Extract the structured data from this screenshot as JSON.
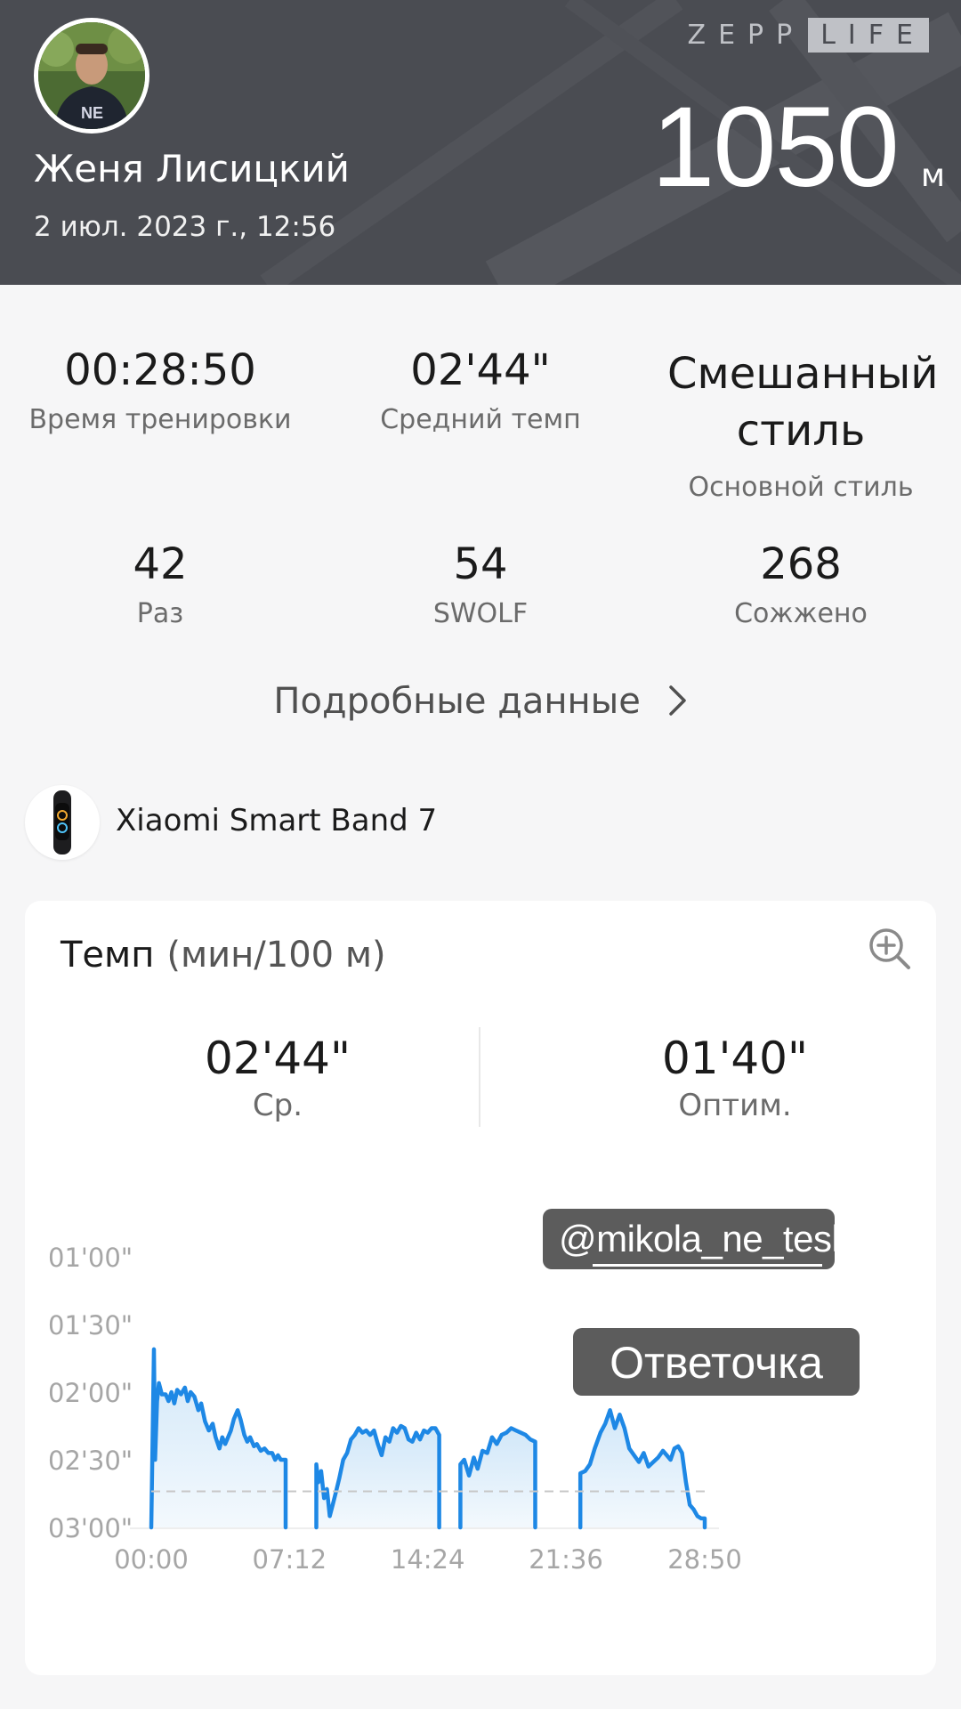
{
  "header": {
    "brand_left": "ZEPP",
    "brand_right": "LIFE",
    "user_name": "Женя Лисицкий",
    "date": "2 июл. 2023 г., 12:56",
    "distance_value": "1050",
    "distance_unit": "м"
  },
  "stats": [
    {
      "value": "00:28:50",
      "label": "Время тренировки"
    },
    {
      "value": "02'44\"",
      "label": "Средний темп"
    },
    {
      "value": "Смешанный стиль",
      "label": "Основной стиль"
    },
    {
      "value": "42",
      "label": "Раз"
    },
    {
      "value": "54",
      "label": "SWOLF"
    },
    {
      "value": "268",
      "label": "Сожжено"
    }
  ],
  "details_link": "Подробные данные",
  "device": {
    "name": "Xiaomi Smart Band 7",
    "icon": "smart-band-icon"
  },
  "pace_card": {
    "title": "Темп",
    "unit": "(мин/100 м)",
    "zoom_icon": "zoom-in-icon",
    "avg_value": "02'44\"",
    "avg_label": "Ср.",
    "best_value": "01'40\"",
    "best_label": "Оптим."
  },
  "overlays": {
    "username": "@mikola_ne_tesla",
    "caption": "Ответочка"
  },
  "chart_data": {
    "type": "area",
    "y_tick_labels": [
      "01'00\"",
      "01'30\"",
      "02'00\"",
      "02'30\"",
      "03'00\""
    ],
    "y_ticks_seconds": [
      60,
      90,
      120,
      150,
      180
    ],
    "ylim_seconds": [
      60,
      180
    ],
    "y_inverted": true,
    "x_tick_labels": [
      "00:00",
      "07:12",
      "14:24",
      "21:36",
      "28:50"
    ],
    "x_ticks_minutes": [
      0,
      7.2,
      14.4,
      21.6,
      28.83
    ],
    "xlim_minutes": [
      0,
      28.83
    ],
    "average_line_seconds": 164,
    "line_color": "#1e88e5",
    "fill_color": "#cfe6f8",
    "segments": [
      {
        "x": [
          0.0,
          0.14,
          0.2,
          0.3,
          0.4,
          0.55,
          0.75,
          0.9,
          1.05,
          1.2,
          1.35,
          1.55,
          1.75,
          1.9,
          2.05,
          2.25,
          2.45,
          2.6,
          2.8,
          3.0,
          3.2,
          3.35,
          3.55,
          3.7,
          3.85,
          4.0,
          4.15,
          4.3,
          4.5,
          4.65,
          4.85,
          5.0,
          5.15,
          5.35,
          5.5,
          5.7,
          5.9,
          6.1,
          6.3,
          6.45,
          6.6,
          6.75,
          6.9,
          7.0,
          7.0
        ],
        "y": [
          180,
          101,
          150,
          124,
          116,
          121,
          121,
          124,
          120,
          125,
          119,
          121,
          118,
          124,
          120,
          122,
          128,
          125,
          133,
          137,
          134,
          140,
          145,
          140,
          143,
          140,
          137,
          132,
          128,
          132,
          139,
          142,
          140,
          144,
          143,
          146,
          145,
          147,
          147,
          150,
          148,
          150,
          150,
          150,
          180
        ]
      },
      {
        "x": [
          8.6,
          8.6,
          8.7,
          8.85,
          9.0,
          9.15,
          9.3,
          9.45,
          9.6,
          9.8,
          10.0,
          10.2,
          10.4,
          10.6,
          10.8,
          11.0,
          11.2,
          11.4,
          11.6,
          11.8,
          12.0,
          12.2,
          12.4,
          12.6,
          12.8,
          13.0,
          13.2,
          13.4,
          13.6,
          13.8,
          14.0,
          14.2,
          14.4,
          14.6,
          14.8,
          15.0,
          15.0
        ],
        "y": [
          180,
          152,
          160,
          155,
          167,
          163,
          175,
          170,
          165,
          158,
          150,
          147,
          141,
          139,
          136,
          138,
          137,
          139,
          137,
          143,
          148,
          140,
          142,
          136,
          138,
          135,
          136,
          141,
          142,
          138,
          141,
          137,
          138,
          136,
          136,
          139,
          180
        ]
      },
      {
        "x": [
          16.1,
          16.1,
          16.3,
          16.55,
          16.8,
          17.0,
          17.25,
          17.5,
          17.75,
          18.0,
          18.25,
          18.5,
          18.75,
          19.0,
          19.25,
          19.5,
          19.75,
          20.0,
          20.0
        ],
        "y": [
          180,
          152,
          150,
          157,
          149,
          154,
          146,
          147,
          140,
          143,
          139,
          138,
          136,
          137,
          138,
          139,
          141,
          142,
          180
        ]
      },
      {
        "x": [
          22.35,
          22.35,
          22.6,
          22.85,
          23.1,
          23.4,
          23.65,
          23.9,
          24.15,
          24.4,
          24.65,
          24.9,
          25.15,
          25.4,
          25.65,
          25.9,
          26.15,
          26.4,
          26.65,
          26.85,
          27.05,
          27.25,
          27.45,
          27.65,
          27.85,
          28.05,
          28.25,
          28.45,
          28.65,
          28.83,
          28.83
        ],
        "y": [
          180,
          156,
          155,
          152,
          145,
          138,
          134,
          128,
          136,
          130,
          136,
          145,
          148,
          151,
          147,
          153,
          151,
          149,
          146,
          148,
          150,
          145,
          144,
          147,
          160,
          170,
          172,
          175,
          176,
          176,
          180
        ]
      }
    ]
  }
}
